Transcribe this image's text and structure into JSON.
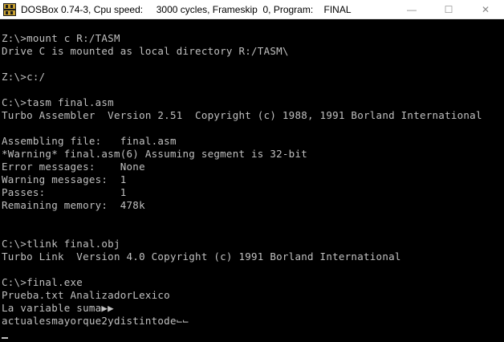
{
  "window": {
    "title": "DOSBox 0.74-3, Cpu speed:     3000 cycles, Frameskip  0, Program:    FINAL",
    "icon": "dosbox-icon",
    "controls": {
      "minimize": "—",
      "maximize": "☐",
      "close": "✕"
    }
  },
  "console": {
    "lines": [
      "Z:\\>mount c R:/TASM",
      "Drive C is mounted as local directory R:/TASM\\",
      "",
      "Z:\\>c:/",
      "",
      "C:\\>tasm final.asm",
      "Turbo Assembler  Version 2.51  Copyright (c) 1988, 1991 Borland International",
      "",
      "Assembling file:   final.asm",
      "*Warning* final.asm(6) Assuming segment is 32-bit",
      "Error messages:    None",
      "Warning messages:  1",
      "Passes:            1",
      "Remaining memory:  478k",
      "",
      "",
      "C:\\>tlink final.obj",
      "Turbo Link  Version 4.0 Copyright (c) 1991 Borland International",
      "",
      "C:\\>final.exe",
      "Prueba.txt AnalizadorLexico",
      "La variable suma▶▶",
      "actualesmayorque2ydistintode⌙⌙"
    ]
  }
}
